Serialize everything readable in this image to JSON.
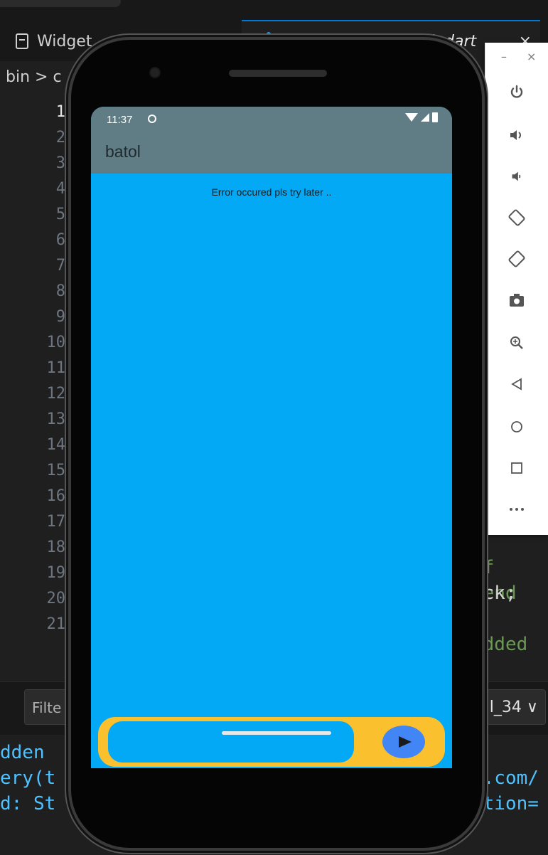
{
  "editor": {
    "tabs": [
      {
        "label": "Widget",
        "icon": "file-icon"
      },
      {
        "label": "schedule_microtask.dart",
        "icon": "dart-icon",
        "close": "×"
      }
    ],
    "breadcrumb": "bin > c",
    "line_numbers": [
      "1",
      "2",
      "3",
      "4",
      "5",
      "6",
      "7",
      "8",
      "9",
      "10",
      "11",
      "12",
      "13",
      "14",
      "15",
      "16",
      "17",
      "18",
      "19",
      "20",
      "21"
    ],
    "code_fragments": {
      "l18": "of pend",
      "l19": "ack;",
      "l21": "added b"
    },
    "filter_placeholder": "Filte",
    "device_select": "l_34 ∨",
    "terminal": {
      "line1": "dden",
      "line2a": "ery(t",
      "line2b": "l.com/",
      "line3a": "d: St",
      "line3b": "ption="
    }
  },
  "emulator_toolbar": {
    "minimize": "–",
    "close": "×",
    "buttons": [
      {
        "name": "power-icon",
        "glyph": "⏻"
      },
      {
        "name": "volume-up-icon",
        "glyph": "🔊"
      },
      {
        "name": "volume-down-icon",
        "glyph": "🔈"
      },
      {
        "name": "rotate-left-icon",
        "glyph": "⟲"
      },
      {
        "name": "rotate-right-icon",
        "glyph": "⟳"
      },
      {
        "name": "camera-icon",
        "glyph": "📷"
      },
      {
        "name": "zoom-icon",
        "glyph": "⊕"
      },
      {
        "name": "back-icon",
        "glyph": "◁"
      },
      {
        "name": "home-icon",
        "glyph": "○"
      },
      {
        "name": "overview-icon",
        "glyph": "□"
      },
      {
        "name": "more-icon",
        "glyph": "···"
      }
    ]
  },
  "phone": {
    "status_time": "11:37",
    "app_title": "batol",
    "error_message": "Error occured pls try later ..",
    "composer_input_value": "",
    "colors": {
      "appbar": "#607d85",
      "body": "#03a9f4",
      "composer": "#fbc02d",
      "send_button": "#4285f4"
    }
  }
}
